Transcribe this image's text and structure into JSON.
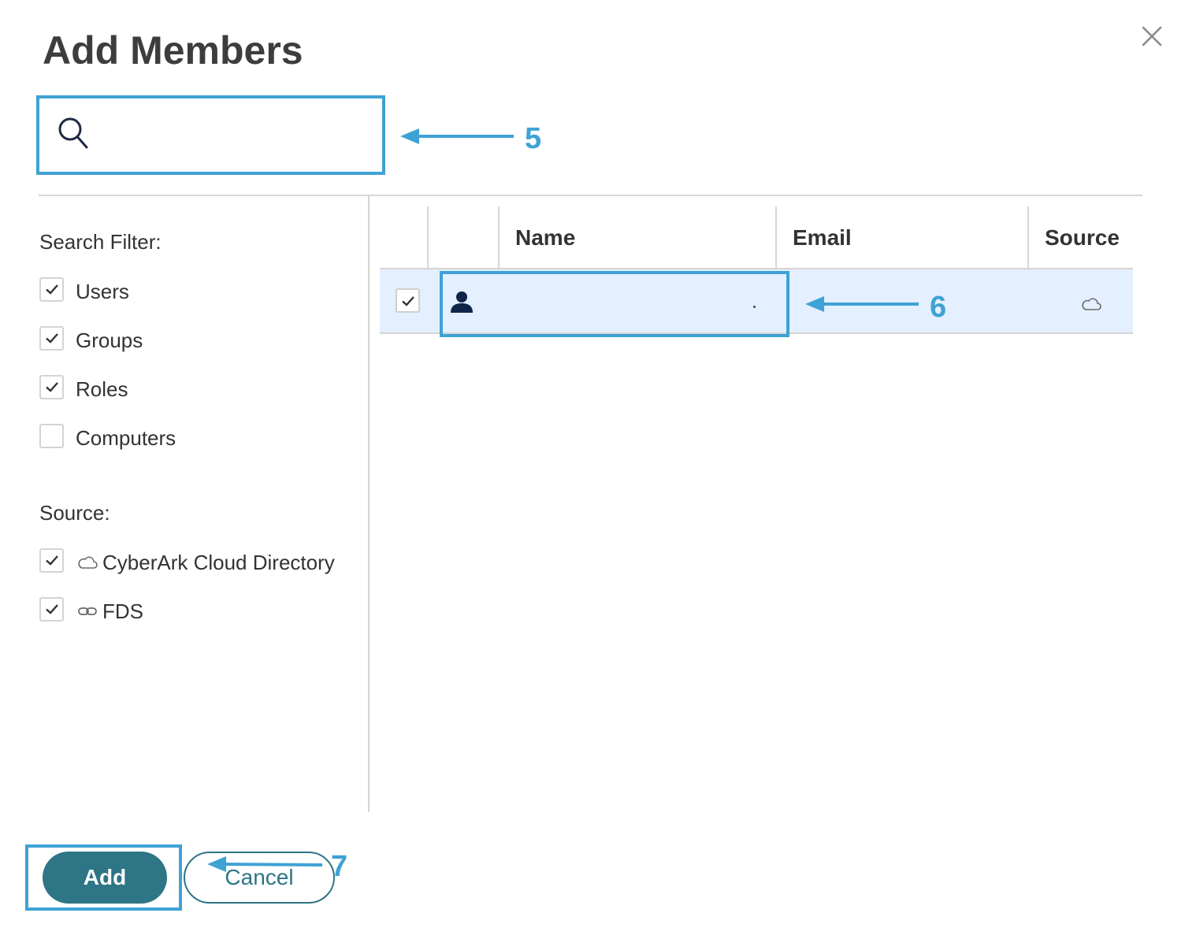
{
  "dialog": {
    "title": "Add Members"
  },
  "search": {
    "placeholder": "",
    "value": ""
  },
  "filters": {
    "search_filter_heading": "Search Filter:",
    "types": [
      {
        "label": "Users",
        "checked": true
      },
      {
        "label": "Groups",
        "checked": true
      },
      {
        "label": "Roles",
        "checked": true
      },
      {
        "label": "Computers",
        "checked": false
      }
    ],
    "source_heading": "Source:",
    "sources": [
      {
        "label": "CyberArk Cloud Directory",
        "icon": "cloud-icon",
        "checked": true
      },
      {
        "label": "FDS",
        "icon": "link-icon",
        "checked": true
      }
    ]
  },
  "grid": {
    "columns": [
      "Name",
      "Email",
      "Source"
    ],
    "rows": [
      {
        "type_icon": "user-icon",
        "name": "",
        "email": "",
        "source_icon": "cloud-icon",
        "checked": true,
        "selected": true
      }
    ]
  },
  "footer": {
    "add_label": "Add",
    "cancel_label": "Cancel"
  },
  "annotations": {
    "step_5": "5",
    "step_6": "6",
    "step_7": "7"
  },
  "colors": {
    "accent": "#2e7585",
    "annotation": "#3fa2d4",
    "selected_row": "#e4efff",
    "divider": "#d6d6d6"
  }
}
